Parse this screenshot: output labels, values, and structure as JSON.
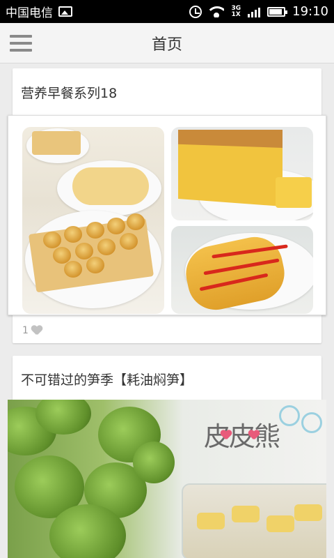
{
  "status_bar": {
    "carrier": "中国电信",
    "network": [
      "3G",
      "1X"
    ],
    "time": "19:10"
  },
  "header": {
    "title": "首页",
    "menu_icon": "hamburger-menu-icon"
  },
  "feed": [
    {
      "title": "营养早餐系列18",
      "like_count": "1",
      "like_icon": "heart-icon"
    },
    {
      "title": "不可错过的笋季【耗油焖笋】",
      "watermark_logo": "皮皮熊"
    }
  ],
  "colors": {
    "background": "#ececec",
    "card": "#ffffff",
    "title_text": "#333333",
    "status_bar": "#000000"
  }
}
